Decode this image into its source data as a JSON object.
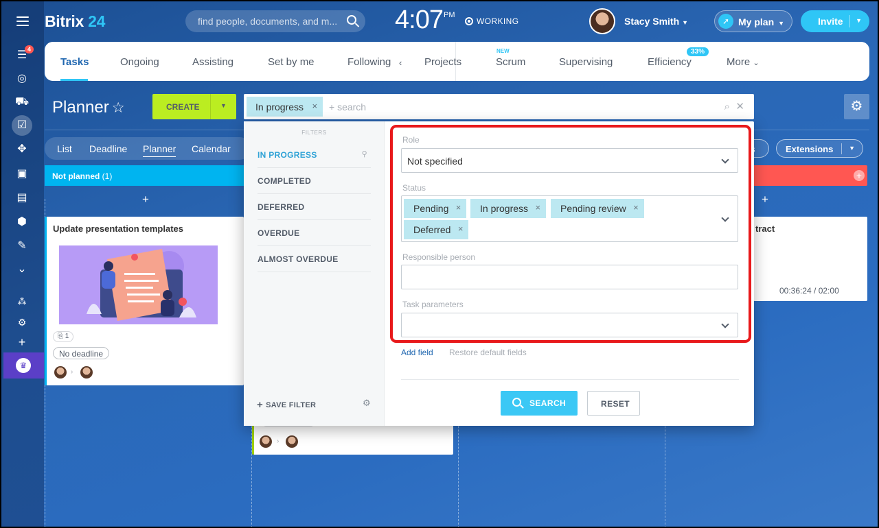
{
  "header": {
    "brand_name": "Bitrix",
    "brand_num": "24",
    "search_placeholder": "find people, documents, and m...",
    "clock": "4:07",
    "clock_suffix": "PM",
    "work_status": "WORKING",
    "user_name": "Stacy Smith",
    "myplan_label": "My plan",
    "invite_label": "Invite"
  },
  "sidebar": {
    "badge": "4",
    "icons": [
      "filter-icon",
      "target-icon",
      "cart-icon",
      "tasks-icon",
      "crm-icon",
      "contact-card-icon",
      "robot-icon",
      "box-icon",
      "signature-icon",
      "chevron-circle-icon",
      "sitemap-icon",
      "gear-icon",
      "plus-icon",
      "crown-icon"
    ]
  },
  "tabs": {
    "items": [
      "Tasks",
      "Ongoing",
      "Assisting",
      "Set by me",
      "Following",
      "Projects",
      "Scrum",
      "Supervising",
      "Efficiency",
      "More"
    ],
    "new_label": "NEW",
    "efficiency_badge": "33%"
  },
  "planner": {
    "title": "Planner",
    "create_label": "CREATE",
    "filter_chip": "In progress",
    "filter_search": "+ search"
  },
  "views": {
    "items": [
      "List",
      "Deadline",
      "Planner",
      "Calendar"
    ],
    "active": "Planner",
    "extensions_label": "Extensions",
    "ext_left_fragment": "s"
  },
  "kanban": {
    "column1_title": "Not planned",
    "column1_count": "(1)",
    "add_symbol": "+",
    "card1": {
      "title": "Update presentation templates",
      "checklist": "1",
      "deadline": "No deadline"
    },
    "card3": {
      "title_fragment": "tract",
      "timer": "00:36:24 / 02:00"
    }
  },
  "filter_popup": {
    "presets_header": "FILTERS",
    "presets": [
      "IN PROGRESS",
      "COMPLETED",
      "DEFERRED",
      "OVERDUE",
      "ALMOST OVERDUE"
    ],
    "active_preset": "IN PROGRESS",
    "save_filter": "SAVE FILTER",
    "fields": {
      "role_label": "Role",
      "role_value": "Not specified",
      "status_label": "Status",
      "status_tags": [
        "Pending",
        "In progress",
        "Pending review",
        "Deferred"
      ],
      "responsible_label": "Responsible person",
      "responsible_value": "",
      "params_label": "Task parameters",
      "params_value": ""
    },
    "add_field": "Add field",
    "restore_fields": "Restore default fields",
    "search_button": "SEARCH",
    "reset_button": "RESET"
  },
  "colors": {
    "accent": "#2fc6f6",
    "create_green": "#bbed21",
    "highlight_red": "#e8191b",
    "column_blue": "#00b4f0",
    "column_red": "#ff5752"
  }
}
